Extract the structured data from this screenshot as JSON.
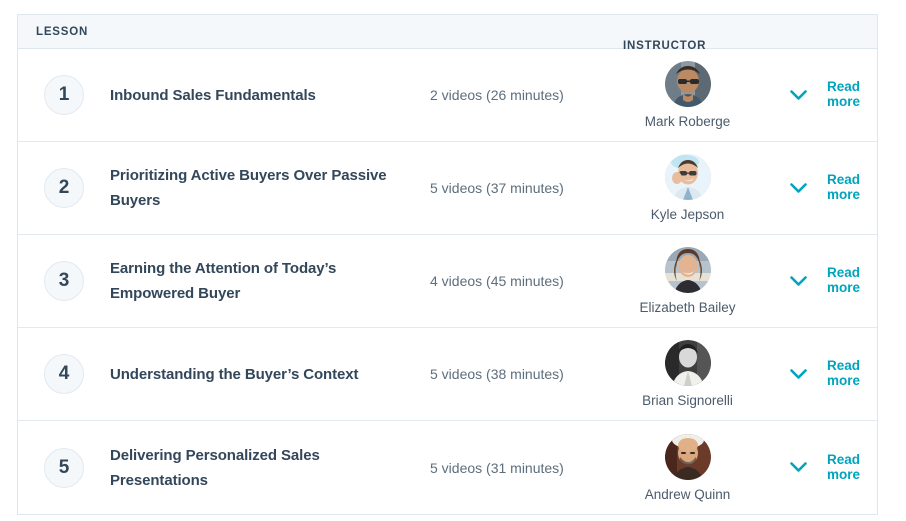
{
  "table": {
    "columns": {
      "lesson": "LESSON",
      "instructor": "INSTRUCTOR"
    },
    "accent_color": "#00a4bd",
    "header_bg": "#f5f8fa",
    "border_color": "#dfe6ee",
    "title_color": "#33475b",
    "read_more_label": "Read more",
    "chevron_icon": "chevron-down-icon",
    "rows": [
      {
        "number": "1",
        "title": "Inbound Sales Fundamentals",
        "videos": "2 videos (26 minutes)",
        "instructor": "Mark Roberge",
        "read_more": "Read more"
      },
      {
        "number": "2",
        "title": "Prioritizing Active Buyers Over Passive Buyers",
        "videos": "5 videos (37 minutes)",
        "instructor": "Kyle Jepson",
        "read_more": "Read more"
      },
      {
        "number": "3",
        "title": "Earning the Attention of Today’s Empowered Buyer",
        "videos": "4 videos (45 minutes)",
        "instructor": "Elizabeth Bailey",
        "read_more": "Read more"
      },
      {
        "number": "4",
        "title": "Understanding the Buyer’s Context",
        "videos": "5 videos (38 minutes)",
        "instructor": "Brian Signorelli",
        "read_more": "Read more"
      },
      {
        "number": "5",
        "title": "Delivering Personalized Sales Presentations",
        "videos": "5 videos (31 minutes)",
        "instructor": "Andrew Quinn",
        "read_more": "Read more"
      }
    ]
  }
}
